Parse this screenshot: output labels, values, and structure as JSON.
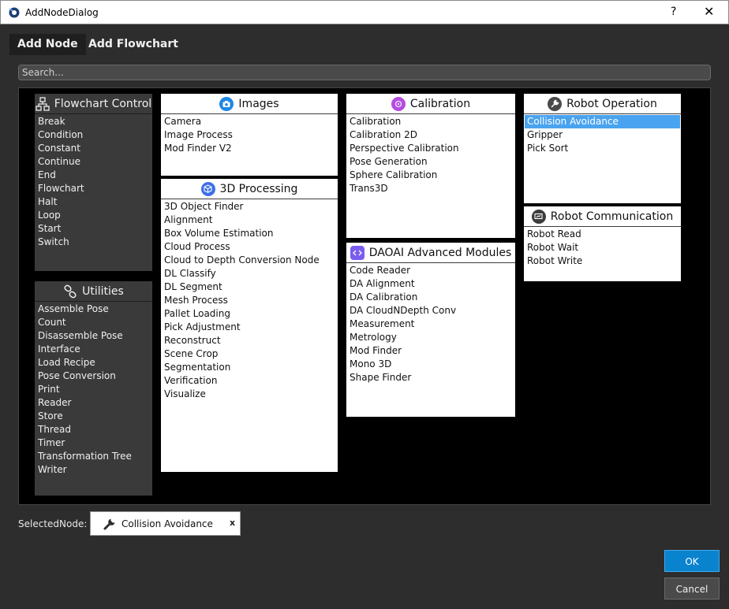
{
  "window": {
    "title": "AddNodeDialog",
    "help": "?",
    "close": "✕"
  },
  "tabs": [
    {
      "label": "Add Node",
      "active": true
    },
    {
      "label": "Add Flowchart",
      "active": false
    }
  ],
  "search": {
    "placeholder": "Search..."
  },
  "panels": {
    "flowchart_control": {
      "title": "Flowchart Control",
      "icon": "flowchart-icon",
      "items": [
        "Break",
        "Condition",
        "Constant",
        "Continue",
        "End",
        "Flowchart",
        "Halt",
        "Loop",
        "Start",
        "Switch"
      ]
    },
    "utilities": {
      "title": "Utilities",
      "icon": "link-icon",
      "items": [
        "Assemble Pose",
        "Count",
        "Disassemble Pose",
        "Interface",
        "Load Recipe",
        "Pose Conversion",
        "Print",
        "Reader",
        "Store",
        "Thread",
        "Timer",
        "Transformation Tree",
        "Writer"
      ]
    },
    "images": {
      "title": "Images",
      "icon": "camera-icon",
      "icon_color": "#1e88e5",
      "items": [
        "Camera",
        "Image Process",
        "Mod Finder V2"
      ]
    },
    "processing_3d": {
      "title": "3D Processing",
      "icon": "cube-icon",
      "icon_color": "#3d6fe8",
      "items": [
        "3D Object Finder",
        "Alignment",
        "Box Volume Estimation",
        "Cloud Process",
        "Cloud to Depth Conversion Node",
        "DL Classify",
        "DL Segment",
        "Mesh Process",
        "Pallet Loading",
        "Pick Adjustment",
        "Reconstruct",
        "Scene Crop",
        "Segmentation",
        "Verification",
        "Visualize"
      ]
    },
    "calibration": {
      "title": "Calibration",
      "icon": "target-icon",
      "icon_color": "#b44de0",
      "items": [
        "Calibration",
        "Calibration 2D",
        "Perspective Calibration",
        "Pose Generation",
        "Sphere Calibration",
        "Trans3D"
      ]
    },
    "daoai_advanced": {
      "title": "DAOAI Advanced Modules",
      "icon": "code-icon",
      "icon_color": "#7a5cf0",
      "items": [
        "Code Reader",
        "DA Alignment",
        "DA Calibration",
        "DA CloudNDepth Conv",
        "Measurement",
        "Metrology",
        "Mod Finder",
        "Mono 3D",
        "Shape Finder"
      ]
    },
    "robot_operation": {
      "title": "Robot Operation",
      "icon": "wrench-icon",
      "icon_color": "#4a4a4a",
      "items": [
        "Collision Avoidance",
        "Gripper",
        "Pick Sort"
      ],
      "selected_index": 0
    },
    "robot_communication": {
      "title": "Robot Communication",
      "icon": "screen-icon",
      "icon_color": "#3c3c3c",
      "items": [
        "Robot Read",
        "Robot Wait",
        "Robot Write"
      ]
    }
  },
  "selected_node": {
    "label": "SelectedNode:",
    "value": "Collision Avoidance",
    "icon": "wrench-icon",
    "clear": "x"
  },
  "buttons": {
    "ok": "OK",
    "cancel": "Cancel"
  },
  "colors": {
    "accent": "#0a83cf",
    "selection": "#4aa3f0"
  }
}
